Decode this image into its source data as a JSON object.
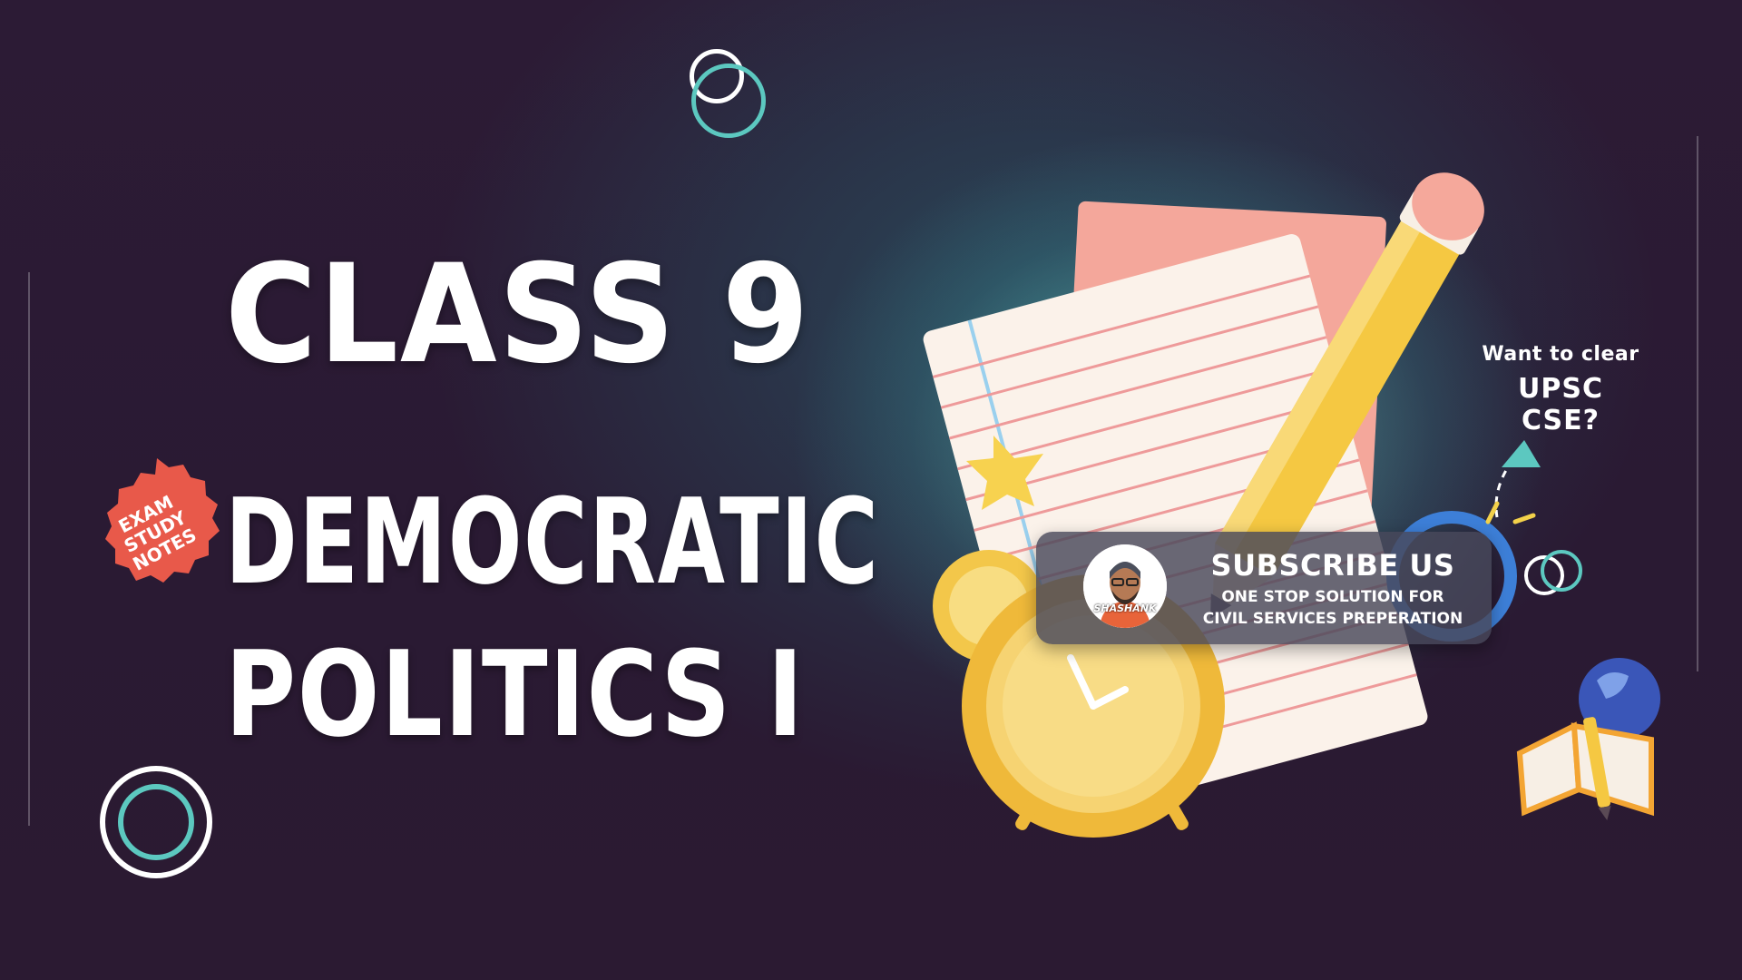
{
  "title": {
    "line1": "CLASS 9",
    "line2": "DEMOCRATIC",
    "line3": "POLITICS I"
  },
  "badge": {
    "line1": "EXAM",
    "line2": "STUDY",
    "line3": "NOTES"
  },
  "upsc": {
    "question": "Want to clear",
    "exam": "UPSC CSE?"
  },
  "subscribe": {
    "title": "SUBSCRIBE US",
    "line1": "ONE STOP SOLUTION FOR",
    "line2": "CIVIL SERVICES PREPERATION",
    "avatar_name": "SHASHANK"
  },
  "colors": {
    "background": "#2b1a33",
    "glow": "#7eebdc",
    "teal_ring": "#5cc8c0",
    "badge": "#e8594a",
    "paper_lines": "#e88a8a",
    "pencil": "#f5c842",
    "clock": "#f3c74a"
  },
  "icons": {
    "badge_icon": "seal-badge-icon",
    "paper_icon": "notepad-icon",
    "pencil_icon": "pencil-icon",
    "clock_icon": "alarm-clock-icon",
    "arrow_icon": "arrow-up-icon",
    "globe_icon": "globe-book-icon"
  }
}
